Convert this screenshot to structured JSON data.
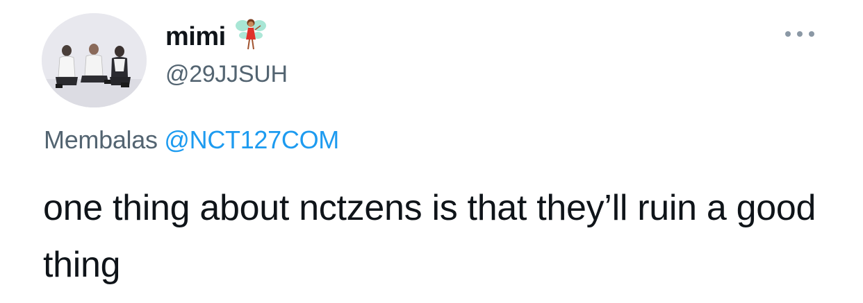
{
  "tweet": {
    "author": {
      "display_name": "mimi",
      "name_emoji": "fairy-emoji",
      "handle": "@29JJSUH",
      "avatar": "avatar-photo-three-people-sitting"
    },
    "more_menu_icon": "more-options-icon",
    "reply_context": {
      "prefix": "Membalas",
      "mention": "@NCT127COM"
    },
    "text": "one thing about nctzens is that they’ll ruin a good thing"
  },
  "colors": {
    "text_primary": "#0f1419",
    "text_secondary": "#536471",
    "link": "#1d9bf0",
    "background": "#ffffff"
  }
}
